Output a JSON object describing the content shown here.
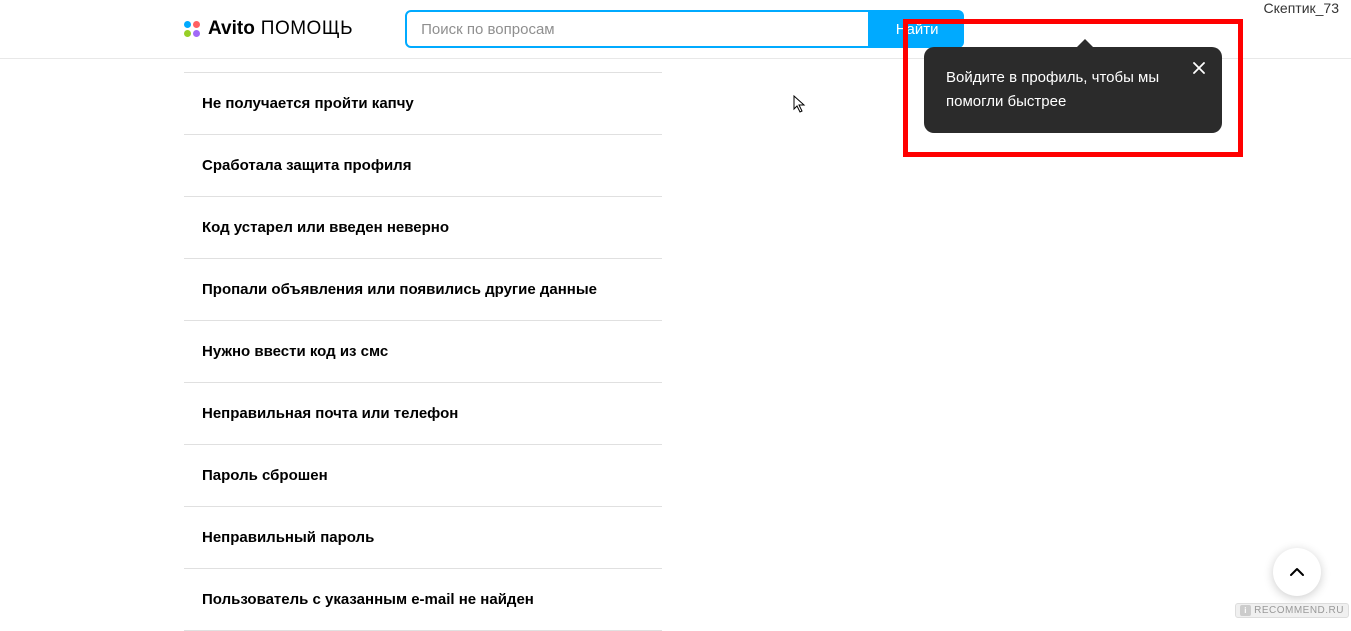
{
  "logo": {
    "brand": "Avito",
    "suffix": "ПОМОЩЬ"
  },
  "search": {
    "placeholder": "Поиск по вопросам",
    "button": "Найти"
  },
  "username": "Скептик_73",
  "list": {
    "items": [
      "Не получается пройти капчу",
      "Сработала защита профиля",
      "Код устарел или введен неверно",
      "Пропали объявления или появились другие данные",
      "Нужно ввести код из смс",
      "Неправильная почта или телефон",
      "Пароль сброшен",
      "Неправильный пароль",
      "Пользователь с указанным e-mail не найден"
    ]
  },
  "tooltip": {
    "line1": "Войдите в профиль, чтобы мы",
    "line2": "помогли быстрее"
  },
  "watermark": "RECOMMEND.RU"
}
